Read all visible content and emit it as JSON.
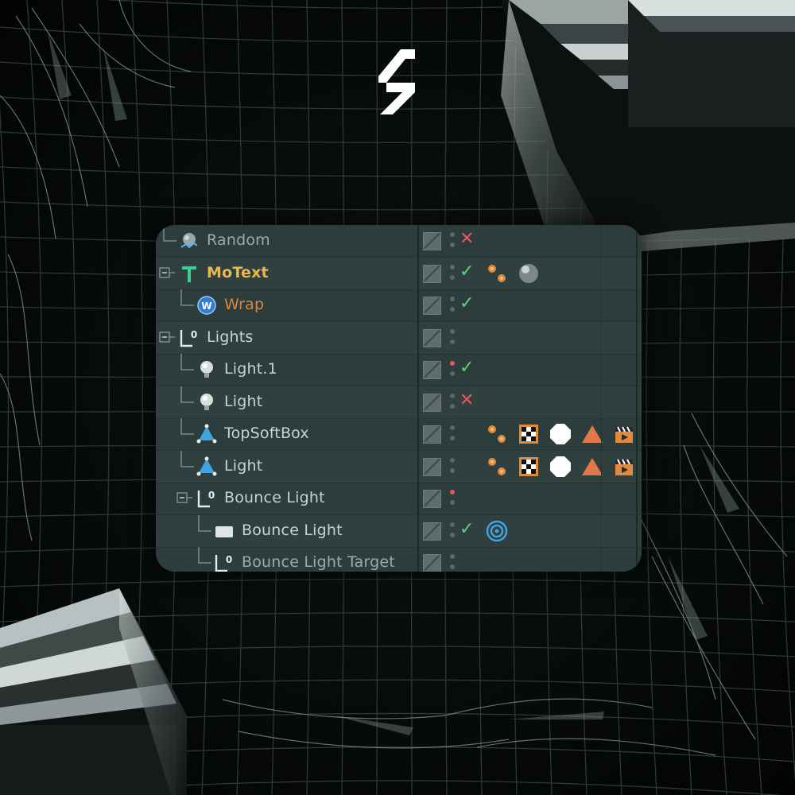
{
  "brand": {
    "logo": "s-logo"
  },
  "object_manager": {
    "rows": [
      {
        "name": "Random",
        "icon": "random-effector-icon",
        "indent": 0,
        "style": "dim",
        "status": "✕",
        "status_type": "cross",
        "dot": "gray",
        "tags": []
      },
      {
        "name": "MoText",
        "icon": "motext-icon",
        "indent": 0,
        "style": "motext",
        "status": "✓",
        "status_type": "check",
        "dot": "gray",
        "tags": [
          "display-tag-icon",
          "material-tag-icon"
        ]
      },
      {
        "name": "Wrap",
        "icon": "wrap-deformer-icon",
        "indent": 1,
        "style": "wrap",
        "status": "✓",
        "status_type": "check",
        "dot": "gray",
        "tags": []
      },
      {
        "name": "Lights",
        "icon": "null-object-icon",
        "indent": 0,
        "style": "normal",
        "status": "",
        "status_type": "none",
        "dot": "gray",
        "tags": []
      },
      {
        "name": "Light.1",
        "icon": "light-bulb-icon",
        "indent": 1,
        "style": "normal",
        "status": "✓",
        "status_type": "check",
        "dot": "red",
        "tags": []
      },
      {
        "name": "Light",
        "icon": "light-bulb-icon",
        "indent": 1,
        "style": "normal",
        "status": "✕",
        "status_type": "cross",
        "dot": "gray",
        "tags": []
      },
      {
        "name": "TopSoftBox",
        "icon": "area-light-icon",
        "indent": 1,
        "style": "normal",
        "status": "",
        "status_type": "none",
        "dot": "gray",
        "tags": [
          "display-tag-icon",
          "checker-tag-icon",
          "octagon-tag-icon",
          "triangle-tag-icon",
          "clapper-tag-icon"
        ]
      },
      {
        "name": "Light",
        "icon": "area-light-icon",
        "indent": 1,
        "style": "normal",
        "status": "",
        "status_type": "none",
        "dot": "gray",
        "tags": [
          "display-tag-icon",
          "checker-tag-icon",
          "octagon-tag-icon",
          "triangle-tag-icon",
          "clapper-tag-icon"
        ]
      },
      {
        "name": "Bounce Light",
        "icon": "null-object-icon",
        "indent": 1,
        "style": "normal",
        "status": "",
        "status_type": "none",
        "dot": "red",
        "tags": []
      },
      {
        "name": "Bounce Light",
        "icon": "plane-light-icon",
        "indent": 2,
        "style": "normal",
        "status": "✓",
        "status_type": "check",
        "dot": "gray",
        "tags": [
          "target-tag-icon"
        ]
      },
      {
        "name": "Bounce Light Target",
        "icon": "null-object-icon",
        "indent": 2,
        "style": "dim",
        "status": "",
        "status_type": "none",
        "dot": "gray",
        "tags": []
      }
    ]
  },
  "colors": {
    "panel": "#2c3d3c",
    "motext": "#e7b857",
    "wrap": "#d6874a",
    "check": "#5fd07a",
    "cross": "#e8575a"
  }
}
